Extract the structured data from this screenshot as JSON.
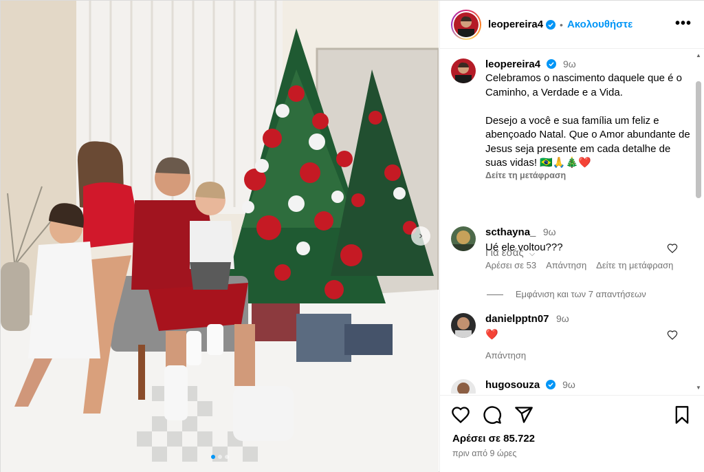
{
  "header": {
    "username": "leopereira4",
    "separator": "•",
    "follow_label": "Ακολουθήστε",
    "more_label": "•••"
  },
  "caption": {
    "username": "leopereira4",
    "time": "9ω",
    "text": "Celebramos o nascimento daquele que é o Caminho, a Verdade e a Vida.\n\nDesejo a você e sua família um feliz e abençoado Natal. Que o Amor abundante de Jesus seja presente em cada detalhe de suas vidas! 🇧🇷🙏🎄❤️",
    "translate_label": "Δείτε τη μετάφραση",
    "for_you_label": "Για εσάς"
  },
  "comments": [
    {
      "username": "scthayna_",
      "time": "9ω",
      "text": "Ué ele voltou???",
      "likes_label": "Αρέσει σε 53",
      "reply_label": "Απάντηση",
      "translate_label": "Δείτε τη μετάφραση",
      "view_replies_label": "Εμφάνιση και των 7 απαντήσεων"
    },
    {
      "username": "danielpptn07",
      "time": "9ω",
      "text": "❤️",
      "reply_label": "Απάντηση"
    },
    {
      "username": "hugosouza",
      "time": "9ω"
    }
  ],
  "footer": {
    "likes": "Αρέσει σε 85.722",
    "time_ago": "πριν από 9 ώρες"
  },
  "carousel": {
    "slides": 3,
    "active_slide": 1
  },
  "icons": {
    "verified": "verified-badge-icon",
    "like": "heart-icon",
    "comment": "comment-icon",
    "share": "share-icon",
    "save": "bookmark-icon",
    "next": "chevron-right-icon"
  },
  "colors": {
    "accent": "#0095f6",
    "secondary_text": "#737373",
    "heart_red": "#ed4956"
  }
}
